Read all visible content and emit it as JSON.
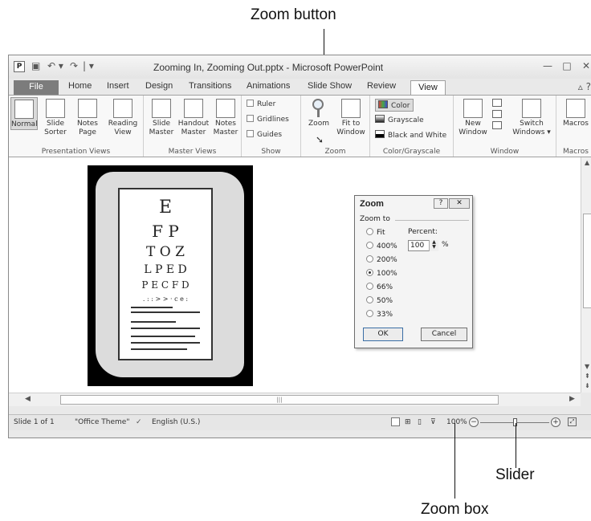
{
  "callouts": {
    "zoom_button": "Zoom button",
    "slider": "Slider",
    "zoom_box": "Zoom box"
  },
  "window": {
    "title": "Zooming In, Zooming Out.pptx - Microsoft PowerPoint",
    "app_icon": "P",
    "qat": {
      "save": "💾",
      "undo": "↶ ▾",
      "redo": "↷",
      "customize": "| ▾"
    },
    "controls": {
      "minimize": "—",
      "maximize": "□",
      "close": "✕"
    }
  },
  "tabs": {
    "file": "File",
    "home": "Home",
    "insert": "Insert",
    "design": "Design",
    "transitions": "Transitions",
    "animations": "Animations",
    "slide_show": "Slide Show",
    "review": "Review",
    "view": "View"
  },
  "ribbon": {
    "presentation_views": {
      "label": "Presentation Views",
      "normal": "Normal",
      "slide_sorter": "Slide Sorter",
      "notes_page": "Notes Page",
      "reading_view": "Reading View"
    },
    "master_views": {
      "label": "Master Views",
      "slide_master": "Slide Master",
      "handout_master": "Handout Master",
      "notes_master": "Notes Master"
    },
    "show": {
      "label": "Show",
      "ruler": "Ruler",
      "gridlines": "Gridlines",
      "guides": "Guides"
    },
    "zoom": {
      "label": "Zoom",
      "zoom": "Zoom",
      "fit_to_window": "Fit to Window"
    },
    "color_grayscale": {
      "label": "Color/Grayscale",
      "color": "Color",
      "grayscale": "Grayscale",
      "black_and_white": "Black and White"
    },
    "window": {
      "label": "Window",
      "new_window": "New Window",
      "switch_windows": "Switch Windows ▾"
    },
    "macros": {
      "label": "Macros",
      "macros": "Macros"
    }
  },
  "eye_chart": {
    "rows": [
      "E",
      "F  P",
      "T  O  Z",
      "L  P  E  D",
      "P E C F D",
      ". : : > > · c e :"
    ]
  },
  "zoom_dialog": {
    "title": "Zoom",
    "help": "?",
    "close": "✕",
    "zoom_to": "Zoom to",
    "percent_label": "Percent:",
    "percent_value": "100",
    "percent_unit": "%",
    "options": [
      "Fit",
      "400%",
      "200%",
      "100%",
      "66%",
      "50%",
      "33%"
    ],
    "selected": "100%",
    "ok": "OK",
    "cancel": "Cancel"
  },
  "statusbar": {
    "slide": "Slide 1 of 1",
    "theme": "\"Office Theme\"",
    "language": "English (U.S.)",
    "zoom_level": "100%",
    "zoom_slider_fraction": 0.5
  },
  "hscroll": {
    "thumb_grip": "|||"
  }
}
